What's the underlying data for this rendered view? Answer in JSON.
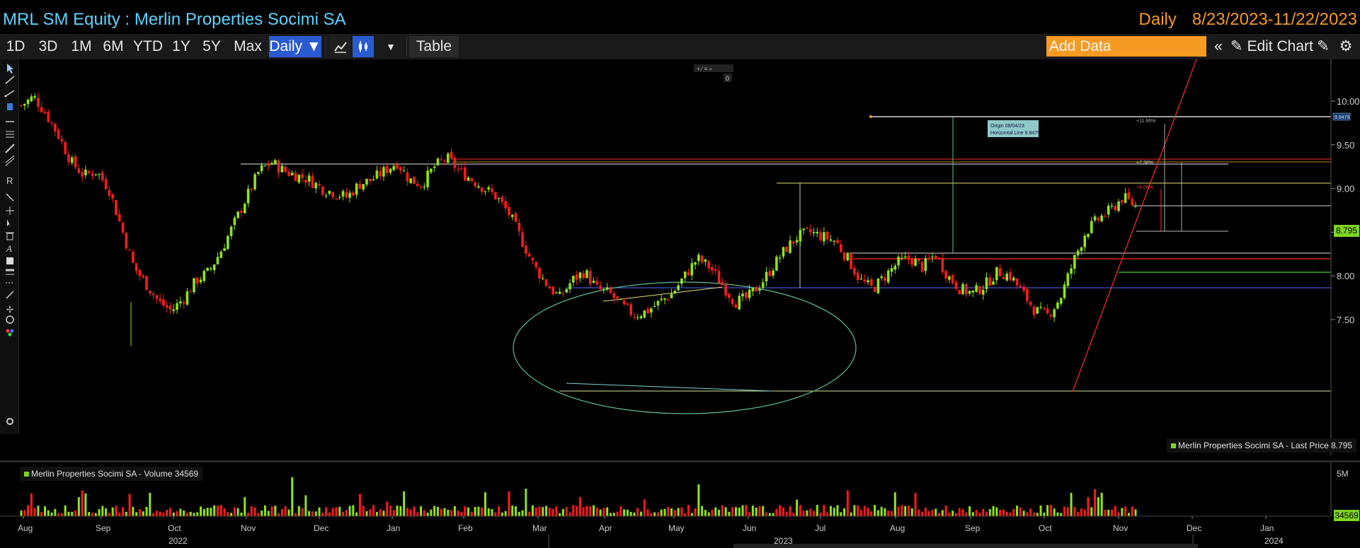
{
  "header": {
    "ticker_title": "MRL SM Equity : Merlin Properties Socimi SA",
    "frequency": "Daily",
    "date_range": "8/23/2023-11/22/2023"
  },
  "toolbar": {
    "periods": [
      "1D",
      "3D",
      "1M",
      "6M",
      "YTD",
      "1Y",
      "5Y",
      "Max"
    ],
    "daily_label": "Daily ▼",
    "table_label": "Table",
    "add_data_placeholder": "Add Data",
    "edit_chart_label": "Edit Chart"
  },
  "colors": {
    "up": "#8fe31c",
    "down": "#ff1a1a",
    "accent_orange": "#f59a23",
    "accent_blue": "#2a5ad0",
    "title_cyan": "#5fd3ff"
  },
  "chart_data": {
    "type": "candlestick",
    "series_name": "Merlin Properties Socimi SA",
    "last_price_label": "Merlin Properties Socimi SA - Last Price 8.795",
    "last_price": 8.795,
    "last_price_badge": "8.795",
    "y_ticks": [
      "10.00",
      "9.50",
      "9.00",
      "8.50",
      "8.00",
      "7.50"
    ],
    "y_tick_values": [
      10.0,
      9.5,
      9.0,
      8.5,
      8.0,
      7.5
    ],
    "ylim": [
      7.2,
      10.35
    ],
    "x_months": [
      "Aug",
      "Sep",
      "Oct",
      "Nov",
      "Dec",
      "Jan",
      "Feb",
      "Mar",
      "Apr",
      "May",
      "Jun",
      "Jul",
      "Aug",
      "Sep",
      "Oct",
      "Nov",
      "Dec",
      "Jan"
    ],
    "x_years": [
      "2022",
      "2023",
      "2024"
    ],
    "close_path": [
      9.95,
      10.05,
      9.85,
      9.6,
      9.3,
      9.15,
      9.2,
      9.0,
      8.55,
      8.1,
      7.9,
      7.7,
      7.6,
      7.75,
      7.95,
      8.05,
      8.3,
      8.6,
      8.9,
      9.2,
      9.3,
      9.2,
      9.15,
      9.1,
      9.0,
      8.95,
      8.9,
      9.05,
      9.1,
      9.2,
      9.3,
      9.1,
      9.05,
      9.25,
      9.35,
      9.2,
      9.1,
      9.0,
      8.9,
      8.7,
      8.4,
      8.1,
      7.9,
      7.75,
      7.95,
      8.05,
      7.85,
      7.8,
      7.65,
      7.55,
      7.6,
      7.7,
      7.8,
      8.0,
      8.2,
      8.1,
      7.9,
      7.7,
      7.75,
      7.9,
      8.1,
      8.3,
      8.45,
      8.5,
      8.45,
      8.4,
      8.2,
      7.95,
      7.85,
      8.0,
      8.15,
      8.2,
      8.1,
      8.25,
      8.0,
      7.85,
      7.8,
      7.9,
      8.05,
      8.0,
      7.8,
      7.6,
      7.55,
      7.75,
      8.15,
      8.5,
      8.65,
      8.75,
      8.9,
      8.8
    ],
    "volume_legend": "Merlin Properties Socimi SA - Volume 34569",
    "volume_badge": "34569",
    "volume_tick": "5M",
    "hline_tag": "9.8479",
    "annotation_line1": "Origin 08/04/23",
    "annotation_line2": "Horizontal Line 9.8479",
    "pct_labels": [
      "+11.96%",
      "+7.38%",
      "+5.08%"
    ]
  }
}
